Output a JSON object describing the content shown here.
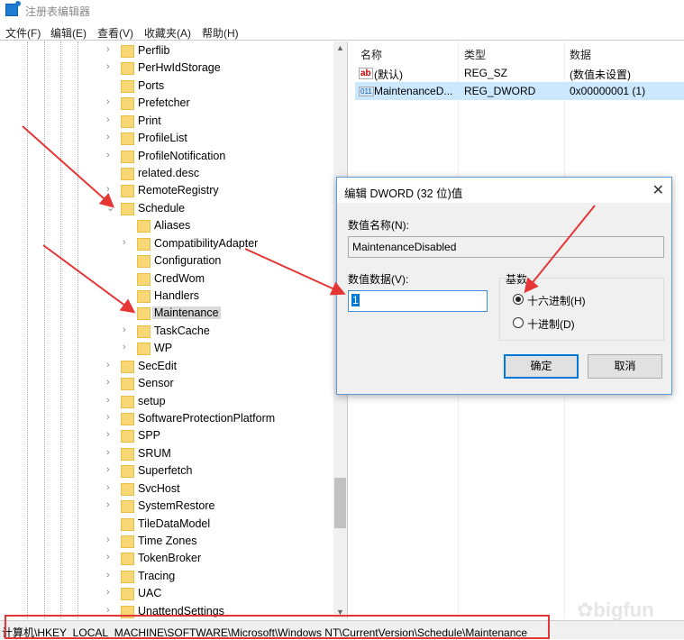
{
  "window": {
    "title": "注册表编辑器"
  },
  "menu": [
    "文件(F)",
    "编辑(E)",
    "查看(V)",
    "收藏夹(A)",
    "帮助(H)"
  ],
  "tree": [
    {
      "label": "Perflib",
      "level": 1,
      "exp": ">"
    },
    {
      "label": "PerHwIdStorage",
      "level": 1,
      "exp": ">"
    },
    {
      "label": "Ports",
      "level": 1,
      "exp": ""
    },
    {
      "label": "Prefetcher",
      "level": 1,
      "exp": ">"
    },
    {
      "label": "Print",
      "level": 1,
      "exp": ">"
    },
    {
      "label": "ProfileList",
      "level": 1,
      "exp": ">"
    },
    {
      "label": "ProfileNotification",
      "level": 1,
      "exp": ">"
    },
    {
      "label": "related.desc",
      "level": 1,
      "exp": ""
    },
    {
      "label": "RemoteRegistry",
      "level": 1,
      "exp": ">"
    },
    {
      "label": "Schedule",
      "level": 1,
      "exp": "v"
    },
    {
      "label": "Aliases",
      "level": 2,
      "exp": ""
    },
    {
      "label": "CompatibilityAdapter",
      "level": 2,
      "exp": ">"
    },
    {
      "label": "Configuration",
      "level": 2,
      "exp": ""
    },
    {
      "label": "CredWom",
      "level": 2,
      "exp": ""
    },
    {
      "label": "Handlers",
      "level": 2,
      "exp": ""
    },
    {
      "label": "Maintenance",
      "level": 2,
      "exp": "",
      "selected": true
    },
    {
      "label": "TaskCache",
      "level": 2,
      "exp": ">"
    },
    {
      "label": "WP",
      "level": 2,
      "exp": ">"
    },
    {
      "label": "SecEdit",
      "level": 1,
      "exp": ">"
    },
    {
      "label": "Sensor",
      "level": 1,
      "exp": ">"
    },
    {
      "label": "setup",
      "level": 1,
      "exp": ">"
    },
    {
      "label": "SoftwareProtectionPlatform",
      "level": 1,
      "exp": ">"
    },
    {
      "label": "SPP",
      "level": 1,
      "exp": ">"
    },
    {
      "label": "SRUM",
      "level": 1,
      "exp": ">"
    },
    {
      "label": "Superfetch",
      "level": 1,
      "exp": ">"
    },
    {
      "label": "SvcHost",
      "level": 1,
      "exp": ">"
    },
    {
      "label": "SystemRestore",
      "level": 1,
      "exp": ">"
    },
    {
      "label": "TileDataModel",
      "level": 1,
      "exp": ""
    },
    {
      "label": "Time Zones",
      "level": 1,
      "exp": ">"
    },
    {
      "label": "TokenBroker",
      "level": 1,
      "exp": ">"
    },
    {
      "label": "Tracing",
      "level": 1,
      "exp": ">"
    },
    {
      "label": "UAC",
      "level": 1,
      "exp": ">"
    },
    {
      "label": "UnattendSettings",
      "level": 1,
      "exp": ">"
    }
  ],
  "list": {
    "headers": {
      "name": "名称",
      "type": "类型",
      "data": "数据"
    },
    "rows": [
      {
        "icon": "ab",
        "name": "(默认)",
        "type": "REG_SZ",
        "data": "(数值未设置)"
      },
      {
        "icon": "011",
        "name": "MaintenanceD...",
        "type": "REG_DWORD",
        "data": "0x00000001 (1)"
      }
    ]
  },
  "dialog": {
    "title": "编辑 DWORD (32 位)值",
    "name_label": "数值名称(N):",
    "name_value": "MaintenanceDisabled",
    "data_label": "数值数据(V):",
    "data_value": "1",
    "base_label": "基数",
    "hex_label": "十六进制(H)",
    "dec_label": "十进制(D)",
    "ok": "确定",
    "cancel": "取消"
  },
  "status": {
    "path": "计算机\\HKEY_LOCAL_MACHINE\\SOFTWARE\\Microsoft\\Windows NT\\CurrentVersion\\Schedule\\Maintenance"
  },
  "watermark": "bigfun"
}
